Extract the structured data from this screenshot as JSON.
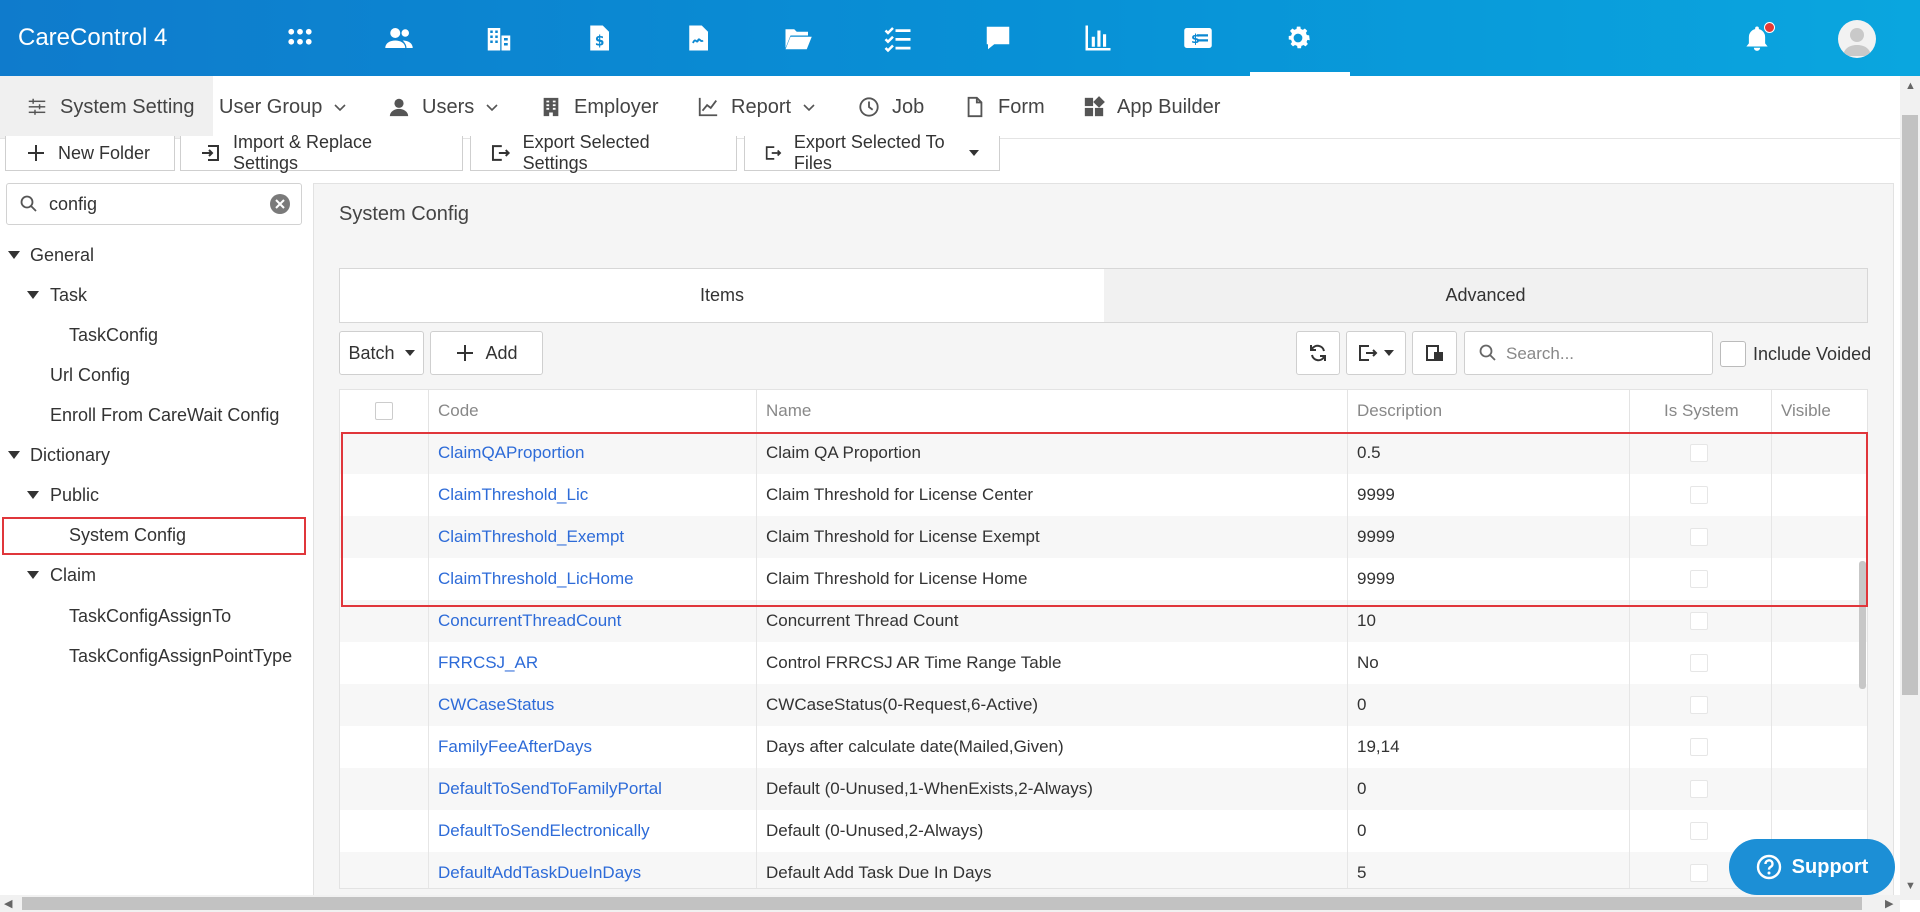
{
  "app": {
    "title": "CareControl 4"
  },
  "top_icons": [
    "grid-icon",
    "people-icon",
    "building-icon",
    "dollar-document-icon",
    "signature-document-icon",
    "folder-icon",
    "checklist-icon",
    "chat-icon",
    "bar-chart-icon",
    "id-card-icon",
    "gear-icon"
  ],
  "subnav": {
    "system_setting": "System Setting",
    "user_group": "User Group",
    "users": "Users",
    "employer": "Employer",
    "report": "Report",
    "job": "Job",
    "form": "Form",
    "app_builder": "App Builder"
  },
  "toolbar": {
    "new_folder": "New Folder",
    "import_replace": "Import & Replace Settings",
    "export_selected": "Export Selected Settings",
    "export_files": "Export Selected To Files"
  },
  "tree": {
    "search_value": "config",
    "general": "General",
    "task": "Task",
    "task_config": "TaskConfig",
    "url_config": "Url Config",
    "enroll_config": "Enroll From CareWait Config",
    "dictionary": "Dictionary",
    "public": "Public",
    "system_config": "System Config",
    "claim": "Claim",
    "assign_to": "TaskConfigAssignTo",
    "assign_point_type": "TaskConfigAssignPointType"
  },
  "panel": {
    "title": "System Config",
    "tab_items": "Items",
    "tab_advanced": "Advanced",
    "batch": "Batch",
    "add": "Add",
    "search_placeholder": "Search...",
    "include_voided": "Include Voided"
  },
  "table": {
    "columns": {
      "code": "Code",
      "name": "Name",
      "description": "Description",
      "is_system": "Is System",
      "visible": "Visible"
    },
    "rows": [
      {
        "code": "ClaimQAProportion",
        "name": "Claim QA Proportion",
        "description": "0.5"
      },
      {
        "code": "ClaimThreshold_Lic",
        "name": "Claim Threshold for License Center",
        "description": "9999"
      },
      {
        "code": "ClaimThreshold_Exempt",
        "name": "Claim Threshold for License Exempt",
        "description": "9999"
      },
      {
        "code": "ClaimThreshold_LicHome",
        "name": "Claim Threshold for License Home",
        "description": "9999"
      },
      {
        "code": "ConcurrentThreadCount",
        "name": "Concurrent Thread Count",
        "description": "10"
      },
      {
        "code": "FRRCSJ_AR",
        "name": "Control FRRCSJ AR Time Range Table",
        "description": "No"
      },
      {
        "code": "CWCaseStatus",
        "name": "CWCaseStatus(0-Request,6-Active)",
        "description": "0"
      },
      {
        "code": "FamilyFeeAfterDays",
        "name": "Days after calculate date(Mailed,Given)",
        "description": "19,14"
      },
      {
        "code": "DefaultToSendToFamilyPortal",
        "name": "Default (0-Unused,1-WhenExists,2-Always)",
        "description": "0"
      },
      {
        "code": "DefaultToSendElectronically",
        "name": "Default (0-Unused,2-Always)",
        "description": "0"
      },
      {
        "code": "DefaultAddTaskDueInDays",
        "name": "Default Add Task Due In Days",
        "description": "5"
      }
    ]
  },
  "support": {
    "label": "Support"
  },
  "colors": {
    "topbar": "#0891d6",
    "link": "#2d6bd8",
    "highlight": "#e0363b",
    "support": "#1c8fd6"
  }
}
